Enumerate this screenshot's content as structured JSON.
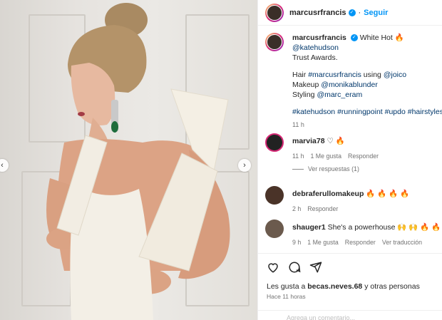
{
  "post": {
    "username": "marcusrfrancis",
    "follow_label": "Seguir",
    "caption": {
      "line1": "White Hot",
      "mention_hudson": "@katehudson",
      "line2": "Trust Awards.",
      "hair_label": "Hair",
      "hair_tag": "#marcusrfrancis",
      "using": "using",
      "hair_brand": "@joico",
      "makeup_label": "Makeup",
      "makeup_mention": "@monikablunder",
      "styling_label": "Styling",
      "styling_mention": "@marc_eram",
      "hashtags": [
        "#katehudson",
        "#runningpoint",
        "#updo",
        "#hairstyles"
      ],
      "time": "11 h"
    }
  },
  "comments": [
    {
      "user": "marvia78",
      "text": "",
      "emoji": "♡ 🔥",
      "time": "11 h",
      "likes": "1 Me gusta",
      "reply": "Responder",
      "view_replies": "Ver respuestas (1)"
    },
    {
      "user": "debraferullomakeup",
      "text": "",
      "emoji": "🔥 🔥 🔥 🔥",
      "time": "2 h",
      "reply": "Responder"
    },
    {
      "user": "shauger1",
      "text": "She's a powerhouse",
      "emoji": "🙌 🙌 🔥 🔥 ❤️ ❤",
      "time": "9 h",
      "likes": "1 Me gusta",
      "reply": "Responder",
      "translate": "Ver traducción"
    }
  ],
  "footer": {
    "likes_prefix": "Les gusta a",
    "likes_user": "becas.neves.68",
    "likes_suffix": "y otras personas",
    "ago": "Hace 11 horas",
    "add_comment_placeholder": "Agrega un comentario..."
  },
  "icons": [
    "heart-icon",
    "comment-icon",
    "share-icon",
    "chevron-left-icon",
    "chevron-right-icon",
    "verified-icon"
  ],
  "colors": {
    "link": "#00376b",
    "follow": "#0095f6",
    "muted": "#737373"
  }
}
